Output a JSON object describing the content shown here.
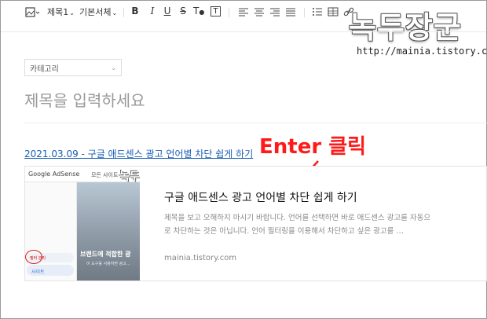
{
  "toolbar": {
    "image_icon": "image-icon",
    "heading_label": "제목1",
    "font_label": "기본서체",
    "bold": "B",
    "italic": "I",
    "underline": "U",
    "strike": "S",
    "color": "T",
    "bg": "T"
  },
  "watermark": {
    "title": "녹두장군",
    "url": "http://mainia.tistory.com"
  },
  "category": {
    "label": "카테고리"
  },
  "post_title_placeholder": "제목을 입력하세요",
  "link_text": "2021.03.09 - 구글 애드센스 광고 언어별 차단 쉽게 하기",
  "annotation": {
    "text": "Enter 클릭",
    "color": "#ff1a1a"
  },
  "card": {
    "title": "구글 애드센스 광고 언어별 차단 쉽게 하기",
    "description": "제목을 보고 오해하지 마시기 바랍니다. 언어를 선택하면 바로 애드센스 광고를 자동으로 차단하는 것은 아닙니다. 언어 필터링을 이용해서 차단하고 싶은 광고를 …",
    "domain": "mainia.tistory.com",
    "thumbnail": {
      "brand": "Google AdSense",
      "tab": "모든 사이트",
      "overlay": "브랜드에 적합한 광",
      "sub": "이 도구를 사용하면 광고...",
      "pill_top": "필터 관리",
      "pill": "사이트",
      "watermark": "녹두"
    }
  },
  "colors": {
    "link": "#1a5fb4",
    "accent_red": "#ff1a1a"
  }
}
